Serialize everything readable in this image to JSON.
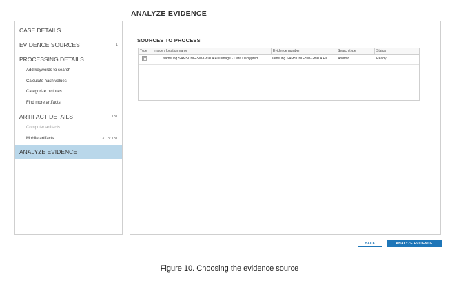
{
  "page_title": "ANALYZE EVIDENCE",
  "sidebar": {
    "items": [
      {
        "label": "CASE DETAILS",
        "count": ""
      },
      {
        "label": "EVIDENCE SOURCES",
        "count": "1"
      },
      {
        "label": "PROCESSING DETAILS",
        "count": ""
      },
      {
        "label": "Add keywords to search",
        "count": ""
      },
      {
        "label": "Calculate hash values",
        "count": ""
      },
      {
        "label": "Categorize pictures",
        "count": ""
      },
      {
        "label": "Find more artifacts",
        "count": ""
      },
      {
        "label": "ARTIFACT DETAILS",
        "count": "131"
      },
      {
        "label": "Computer artifacts",
        "count": ""
      },
      {
        "label": "Mobile artifacts",
        "count": "131 of 131"
      },
      {
        "label": "ANALYZE EVIDENCE",
        "count": ""
      }
    ]
  },
  "main": {
    "section_title": "SOURCES TO PROCESS",
    "table": {
      "columns": [
        "Type",
        "Image / location name",
        "Evidence number",
        "Search type",
        "Status"
      ],
      "rows": [
        {
          "image_name": "samsung SAMSUNG-SM-G891A Full Image - Data Decrypted.",
          "evidence_number": "samsung SAMSUNG-SM-G891A Fu",
          "search_type": "Android",
          "status": "Ready"
        }
      ]
    }
  },
  "buttons": {
    "back": "BACK",
    "analyze": "ANALYZE EVIDENCE"
  },
  "caption": "Figure 10. Choosing the evidence source",
  "colors": {
    "accent": "#1e76b8",
    "active_nav": "#b9d7ea"
  }
}
